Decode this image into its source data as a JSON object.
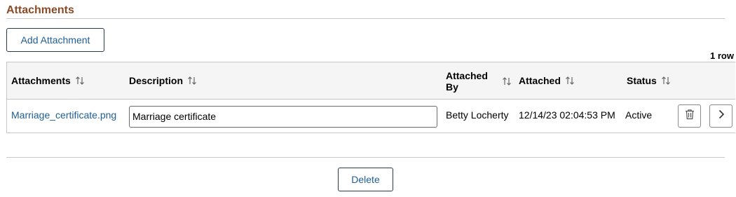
{
  "section": {
    "title": "Attachments"
  },
  "toolbar": {
    "add_label": "Add Attachment",
    "row_count": "1 row"
  },
  "grid": {
    "columns": [
      {
        "label": "Attachments"
      },
      {
        "label": "Description"
      },
      {
        "label": "Attached By"
      },
      {
        "label": "Attached"
      },
      {
        "label": "Status"
      }
    ],
    "rows": [
      {
        "file": "Marriage_certificate.png",
        "description": "Marriage certificate",
        "attached_by": "Betty Locherty",
        "attached": "12/14/23 02:04:53 PM",
        "status": "Active"
      }
    ]
  },
  "footer": {
    "delete_label": "Delete"
  },
  "icons": {
    "sort": "sort-arrows-icon",
    "trash": "trash-icon",
    "chevron": "chevron-right-icon"
  },
  "colors": {
    "title": "#8a4b26",
    "link": "#1d5e95"
  }
}
